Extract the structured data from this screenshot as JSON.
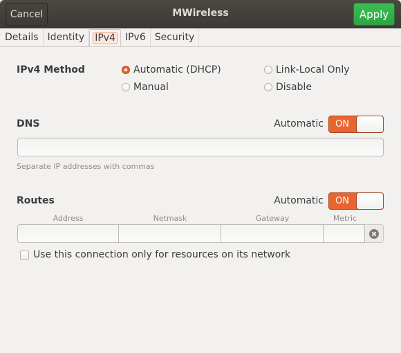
{
  "window": {
    "title": "MWireless",
    "cancel_label": "Cancel",
    "apply_label": "Apply"
  },
  "tabs": [
    {
      "label": "Details",
      "active": false
    },
    {
      "label": "Identity",
      "active": false
    },
    {
      "label": "IPv4",
      "active": true
    },
    {
      "label": "IPv6",
      "active": false
    },
    {
      "label": "Security",
      "active": false
    }
  ],
  "ipv4_method": {
    "label": "IPv4 Method",
    "options": [
      {
        "label": "Automatic (DHCP)",
        "selected": true
      },
      {
        "label": "Link-Local Only",
        "selected": false
      },
      {
        "label": "Manual",
        "selected": false
      },
      {
        "label": "Disable",
        "selected": false
      }
    ]
  },
  "dns": {
    "label": "DNS",
    "automatic_label": "Automatic",
    "switch_state": "ON",
    "value": "",
    "hint": "Separate IP addresses with commas"
  },
  "routes": {
    "label": "Routes",
    "automatic_label": "Automatic",
    "switch_state": "ON",
    "columns": [
      "Address",
      "Netmask",
      "Gateway",
      "Metric"
    ],
    "row": {
      "address": "",
      "netmask": "",
      "gateway": "",
      "metric": ""
    },
    "only_resources_label": "Use this connection only for resources on its network",
    "only_resources_checked": false
  },
  "colors": {
    "accent": "#e9652f",
    "apply": "#34b04b",
    "header": "#45423d"
  }
}
